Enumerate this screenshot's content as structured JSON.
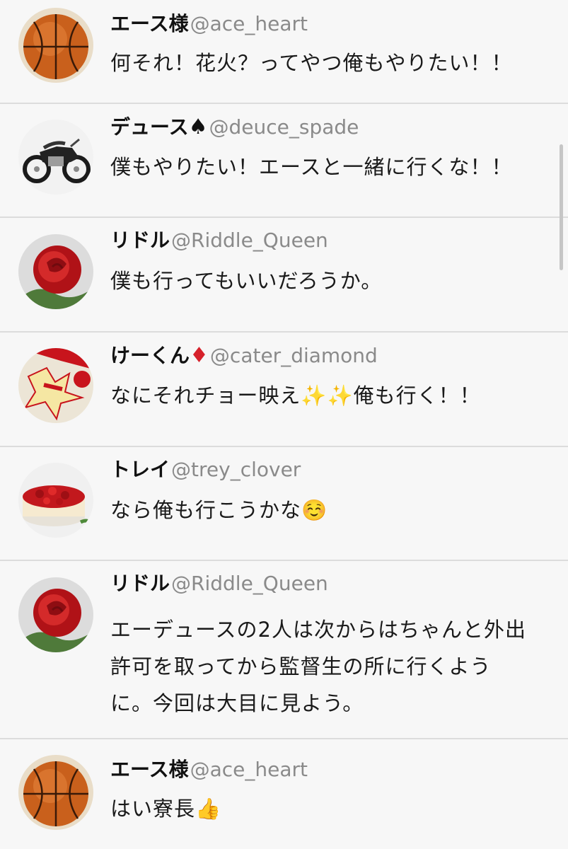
{
  "posts": [
    {
      "name": "エース様",
      "suit": "",
      "handle": "@ace_heart",
      "text": "何それ！花火？ってやつ俺もやりたい！！",
      "avatar": "basketball-avatar"
    },
    {
      "name": "デュース",
      "suit": "♠",
      "handle": "@deuce_spade",
      "text": "僕もやりたい！エースと一緒に行くな！！",
      "avatar": "motorcycle-avatar"
    },
    {
      "name": "リドル",
      "suit": "",
      "handle": "@Riddle_Queen",
      "text": "僕も行ってもいいだろうか。",
      "avatar": "rose-avatar"
    },
    {
      "name": "けーくん",
      "suit": "♦",
      "handle": "@cater_diamond",
      "text": "なにそれチョー映え✨✨俺も行く！！",
      "avatar": "comic-avatar"
    },
    {
      "name": "トレイ",
      "suit": "",
      "handle": "@trey_clover",
      "text": "なら俺も行こうかな☺️",
      "avatar": "cake-avatar"
    },
    {
      "name": "リドル",
      "suit": "",
      "handle": "@Riddle_Queen",
      "text": "エーデュースの2人は次からはちゃんと外出許可を取ってから監督生の所に行くように。今回は大目に見よう。",
      "avatar": "rose-avatar"
    },
    {
      "name": "エース様",
      "suit": "",
      "handle": "@ace_heart",
      "text": "はい寮長👍",
      "avatar": "basketball-avatar"
    }
  ],
  "colors": {
    "background": "#f7f7f7",
    "divider": "#dcdcdc",
    "handle": "#8a8a8a",
    "diamond": "#d6212b",
    "spade": "#111111"
  }
}
